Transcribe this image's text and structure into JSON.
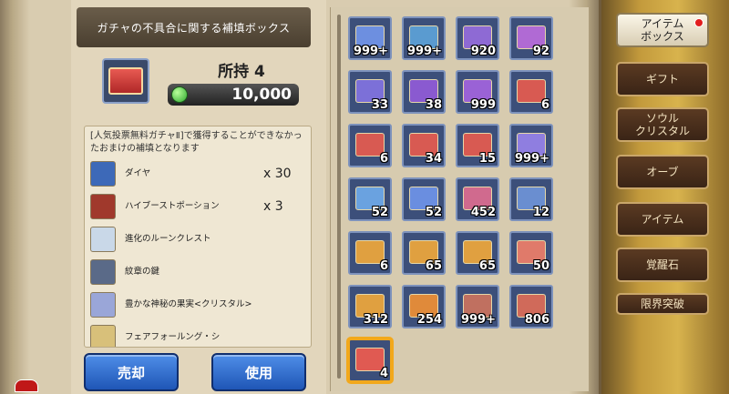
{
  "title": "ガチャの不具合に関する補填ボックス",
  "owned_label": "所持 4",
  "gem_count": "10,000",
  "description": "[人気投票無料ガチャⅡ]で獲得することができなかったおまけの補填となります",
  "rewards": [
    {
      "name": "ダイヤ",
      "qty": "x 30"
    },
    {
      "name": "ハイブーストポーション",
      "qty": "x 3"
    },
    {
      "name": "進化のルーンクレスト",
      "qty": ""
    },
    {
      "name": "紋章の鍵",
      "qty": ""
    },
    {
      "name": "豊かな神秘の果実<クリスタル>",
      "qty": ""
    },
    {
      "name": "フェアフォールング・シ",
      "qty": ""
    }
  ],
  "buttons": {
    "sell": "売却",
    "use": "使用"
  },
  "items": [
    {
      "count": "999+",
      "color": "#6d8fe0"
    },
    {
      "count": "999+",
      "color": "#5a9bd0"
    },
    {
      "count": "920",
      "color": "#8e6ad4"
    },
    {
      "count": "92",
      "color": "#b06ad4"
    },
    {
      "count": "33",
      "color": "#7c70d8"
    },
    {
      "count": "38",
      "color": "#8a5ad0"
    },
    {
      "count": "999",
      "color": "#9a62d6"
    },
    {
      "count": "6",
      "color": "#d85a52"
    },
    {
      "count": "6",
      "color": "#d85a52"
    },
    {
      "count": "34",
      "color": "#d85a52"
    },
    {
      "count": "15",
      "color": "#d85a52"
    },
    {
      "count": "999+",
      "color": "#8f7ee0"
    },
    {
      "count": "52",
      "color": "#6aa2e0"
    },
    {
      "count": "52",
      "color": "#6a8ee0"
    },
    {
      "count": "452",
      "color": "#d06a8e"
    },
    {
      "count": "12",
      "color": "#6a8ed0"
    },
    {
      "count": "6",
      "color": "#e0a040"
    },
    {
      "count": "65",
      "color": "#e0a040"
    },
    {
      "count": "65",
      "color": "#e0a040"
    },
    {
      "count": "50",
      "color": "#e07a6a"
    },
    {
      "count": "312",
      "color": "#e0a040"
    },
    {
      "count": "254",
      "color": "#e08a3a"
    },
    {
      "count": "999+",
      "color": "#c07060"
    },
    {
      "count": "806",
      "color": "#d06a5a"
    },
    {
      "count": "4",
      "color": "#e05a52"
    }
  ],
  "tabs": [
    {
      "label": "アイテム\nボックス",
      "active": true
    },
    {
      "label": "ギフト"
    },
    {
      "label": "ソウル\nクリスタル"
    },
    {
      "label": "オーブ"
    },
    {
      "label": "アイテム"
    },
    {
      "label": "覚醒石"
    },
    {
      "label": "限界突破"
    }
  ]
}
